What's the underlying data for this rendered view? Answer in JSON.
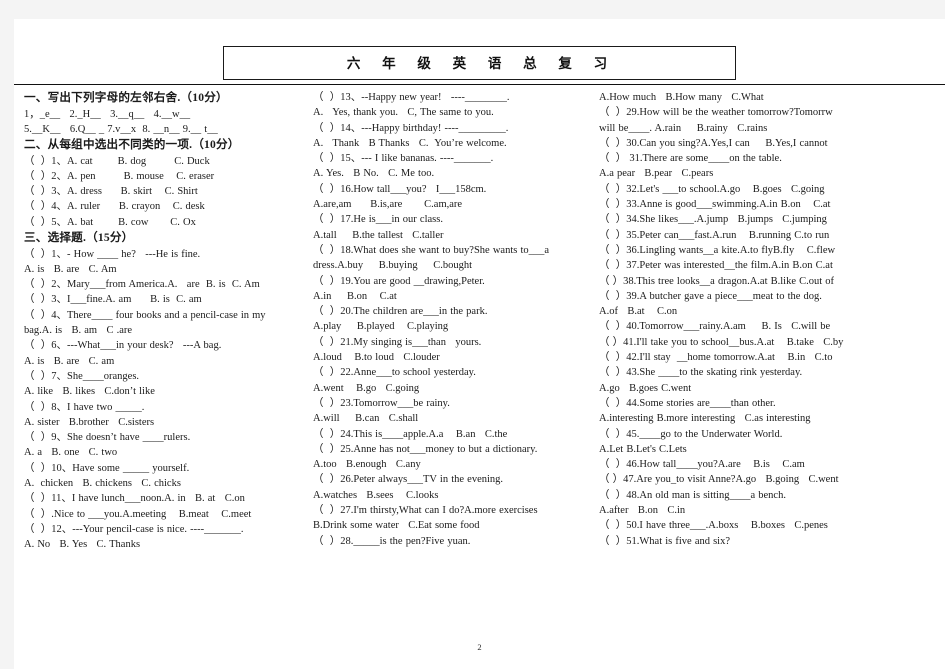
{
  "document": {
    "title": "六  年  级  英  语  总  复  习",
    "page_number": "2"
  },
  "column1": {
    "lines": [
      {
        "text": "一、写出下列字母的左邻右舍.（10分）",
        "cn": true
      },
      {
        "text": "1，_e__   2._H__   3.__q__   4.__w__",
        "cn": false
      },
      {
        "text": "5.__K__   6.Q__ _ 7.v__x  8. __n__ 9.__ t__",
        "cn": false
      },
      {
        "text": "二、从每组中选出不同类的一项.（10分）",
        "cn": true
      },
      {
        "text": "（  ）1、A. cat        B. dog         C. Duck",
        "cn": false
      },
      {
        "text": "（  ）2、A. pen         B. mouse    C. eraser",
        "cn": false
      },
      {
        "text": "（  ）3、A. dress      B. skirt    C. Shirt",
        "cn": false
      },
      {
        "text": "（  ）4、A. ruler      B. crayon    C. desk",
        "cn": false
      },
      {
        "text": "（  ）5、A. bat        B. cow       C. Ox",
        "cn": false
      },
      {
        "text": "三、选择题.（15分）",
        "cn": true
      },
      {
        "text": "（  ）1、- How ____ he?   ---He is fine.",
        "cn": false
      },
      {
        "text": "A. is   B. are   C. Am",
        "cn": false
      },
      {
        "text": "（  ）2、Mary___from America.A.   are  B. is  C. Am",
        "cn": false
      },
      {
        "text": "（  ）3、I___fine.A. am      B. is  C. am",
        "cn": false
      },
      {
        "text": "（  ）4、There____ four books and a pencil-case in my",
        "cn": false
      },
      {
        "text": "bag.A. is   B. am   C .are",
        "cn": false
      },
      {
        "text": "（  ）6、---What___in your desk?   ---A bag.",
        "cn": false
      },
      {
        "text": "A. is   B. are   C. am",
        "cn": false
      },
      {
        "text": "（  ）7、She____oranges.",
        "cn": false
      },
      {
        "text": "A. like   B. likes   C.don’t like",
        "cn": false
      },
      {
        "text": "（  ）8、I have two _____.",
        "cn": false
      },
      {
        "text": "A. sister   B.brother   C.sisters",
        "cn": false
      },
      {
        "text": "（  ）9、She doesn’t have ____rulers.",
        "cn": false
      },
      {
        "text": "A. a   B. one   C. two",
        "cn": false
      },
      {
        "text": "（  ）10、Have some _____ yourself.",
        "cn": false
      },
      {
        "text": "A.  chicken   B. chickens   C. chicks",
        "cn": false
      },
      {
        "text": "（  ）11、I have lunch___noon.A. in   B. at   C.on",
        "cn": false
      },
      {
        "text": "（  ）.Nice to ___you.A.meeting    B.meat    C.meet",
        "cn": false
      },
      {
        "text": "（  ）12、---Your pencil-case is nice. ----_______.",
        "cn": false
      },
      {
        "text": "A. No   B. Yes   C. Thanks",
        "cn": false
      }
    ]
  },
  "column2": {
    "lines": [
      {
        "text": "（  ）13、--Happy new year!   ----________."
      },
      {
        "text": "A.   Yes, thank you.   C, The same to you."
      },
      {
        "text": "（  ）14、---Happy birthday! ----_________."
      },
      {
        "text": "A.   Thank   B Thanks   C.  You’re welcome."
      },
      {
        "text": "（  ）15、--- I like bananas. ----_______."
      },
      {
        "text": "A. Yes.   B No.   C. Me too."
      },
      {
        "text": "（  ）16.How tall___you?   I___158cm."
      },
      {
        "text": "A.are,am      B.is,are       C.am,are"
      },
      {
        "text": "（  ）17.He is___in our class."
      },
      {
        "text": "A.tall     B.the tallest   C.taller"
      },
      {
        "text": "（  ）18.What does she want to buy?She wants to___a"
      },
      {
        "text": "dress.A.buy     B.buying     C.bought"
      },
      {
        "text": "（  ）19.You are good __drawing,Peter."
      },
      {
        "text": "A.in     B.on    C.at"
      },
      {
        "text": "（  ）20.The children are___in the park."
      },
      {
        "text": "A.play     B.played    C.playing"
      },
      {
        "text": "（  ）21.My singing is___than   yours."
      },
      {
        "text": "A.loud    B.to loud   C.louder"
      },
      {
        "text": "（  ）22.Anne___to school yesterday."
      },
      {
        "text": "A.went    B.go   C.going"
      },
      {
        "text": "（  ）23.Tomorrow___be rainy."
      },
      {
        "text": "A.will     B.can   C.shall"
      },
      {
        "text": "（  ）24.This is____apple.A.a    B.an   C.the"
      },
      {
        "text": "（  ）25.Anne has not___money to but a dictionary."
      },
      {
        "text": "A.too   B.enough   C.any"
      },
      {
        "text": "（  ）26.Peter always___TV in the evening."
      },
      {
        "text": "A.watches   B.sees    C.looks"
      },
      {
        "text": "（  ）27.I'm thirsty,What can I do?A.more exercises"
      },
      {
        "text": "B.Drink some water   C.Eat some food"
      },
      {
        "text": "（  ）28._____is the pen?Five yuan."
      }
    ]
  },
  "column3": {
    "lines": [
      {
        "text": "A.How much   B.How many   C.What"
      },
      {
        "text": "（  ）29.How will be the weather tomorrow?Tomorrw"
      },
      {
        "text": "will be____. A.rain     B.rainy   C.rains"
      },
      {
        "text": "（  ）30.Can you sing?A.Yes,I can     B.Yes,I cannot"
      },
      {
        "text": "（  ） 31.There are some____on the table."
      },
      {
        "text": "A.a pear   B.pear   C.pears"
      },
      {
        "text": "（  ）32.Let's ___to school.A.go    B.goes   C.going"
      },
      {
        "text": "（  ）33.Anne is good___swimming.A.in B.on    C.at"
      },
      {
        "text": "（  ）34.She likes___.A.jump   B.jumps   C.jumping"
      },
      {
        "text": "（  ）35.Peter can___fast.A.run    B.running C.to run"
      },
      {
        "text": "（  ）36.Lingling wants__a kite.A.to flyB.fly    C.flew"
      },
      {
        "text": "（  ）37.Peter was interested__the film.A.in B.on C.at"
      },
      {
        "text": "（ ）38.This tree looks__a dragon.A.at B.like C.out of"
      },
      {
        "text": "（  ）39.A butcher gave a piece___meat to the dog."
      },
      {
        "text": "A.of   B.at    C.on"
      },
      {
        "text": "（  ）40.Tomorrow___rainy.A.am     B. Is   C.will be"
      },
      {
        "text": "（ ）41.I'll take you to school__bus.A.at    B.take   C.by"
      },
      {
        "text": "（  ）42.I'll stay  __home tomorrow.A.at    B.in   C.to"
      },
      {
        "text": "（  ）43.She ____to the skating rink yesterday."
      },
      {
        "text": "A.go   B.goes C.went"
      },
      {
        "text": "（  ）44.Some stories are____than other."
      },
      {
        "text": "A.interesting B.more interesting   C.as interesting"
      },
      {
        "text": "（  ）45.____go to the Underwater World."
      },
      {
        "text": "A.Let B.Let's C.Lets"
      },
      {
        "text": "（  ）46.How tall____you?A.are    B.is    C.am"
      },
      {
        "text": "（ ）47.Are you_to visit Anne?A.go   B.going   C.went"
      },
      {
        "text": "（  ）48.An old man is sitting____a bench."
      },
      {
        "text": "A.after   B.on   C.in"
      },
      {
        "text": "（  ）50.I have three___.A.boxs    B.boxes   C.penes"
      },
      {
        "text": "（  ）51.What is five and six?"
      }
    ]
  }
}
